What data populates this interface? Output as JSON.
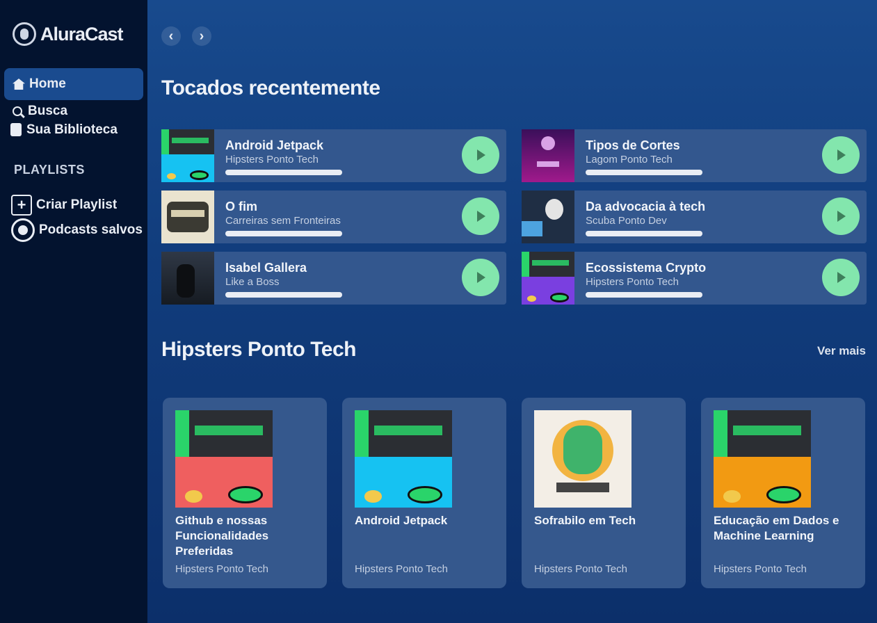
{
  "app": {
    "logo_text": "AluraCast"
  },
  "sidebar": {
    "nav": [
      {
        "label": "Home",
        "icon": "home-icon",
        "active": true
      },
      {
        "label": "Busca",
        "icon": "search-icon",
        "active": false
      },
      {
        "label": "Sua Biblioteca",
        "icon": "library-icon",
        "active": false
      }
    ],
    "playlists_title": "PLAYLISTS",
    "create_playlist": "Criar Playlist",
    "saved_podcasts": "Podcasts salvos"
  },
  "recent": {
    "title": "Tocados recentemente",
    "items": [
      {
        "title": "Android Jetpack",
        "subtitle": "Hipsters Ponto Tech",
        "progress": 1.0,
        "art": "android"
      },
      {
        "title": "Tipos de Cortes",
        "subtitle": "Lagom Ponto Tech",
        "progress": 1.0,
        "art": "purple"
      },
      {
        "title": "O fim",
        "subtitle": "Carreiras sem Fronteiras",
        "progress": 1.0,
        "art": "vintage"
      },
      {
        "title": "Da advocacia à tech",
        "subtitle": "Scuba Ponto Dev",
        "progress": 1.0,
        "art": "portrait"
      },
      {
        "title": "Isabel Gallera",
        "subtitle": "Like a Boss",
        "progress": 1.0,
        "art": "dark"
      },
      {
        "title": "Ecossistema Crypto",
        "subtitle": "Hipsters Ponto Tech",
        "progress": 1.0,
        "art": "crypto"
      }
    ]
  },
  "hipsters": {
    "title": "Hipsters Ponto Tech",
    "see_more": "Ver mais",
    "cards": [
      {
        "title": "Github e nossas Funcionalidades Preferidas",
        "subtitle": "Hipsters Ponto Tech",
        "art": "github"
      },
      {
        "title": "Android Jetpack",
        "subtitle": "Hipsters Ponto Tech",
        "art": "android"
      },
      {
        "title": "Sofrabilo em Tech",
        "subtitle": "Hipsters Ponto Tech",
        "art": "hipster"
      },
      {
        "title": "Educação em Dados e Machine Learning",
        "subtitle": "Hipsters Ponto Tech",
        "art": "ml"
      }
    ]
  },
  "colors": {
    "sidebar_bg": "#03132f",
    "main_bg": "#184a8d",
    "card_bg": "#35588d",
    "play_button": "#83e6ad",
    "active_nav": "#1a4b8f"
  }
}
